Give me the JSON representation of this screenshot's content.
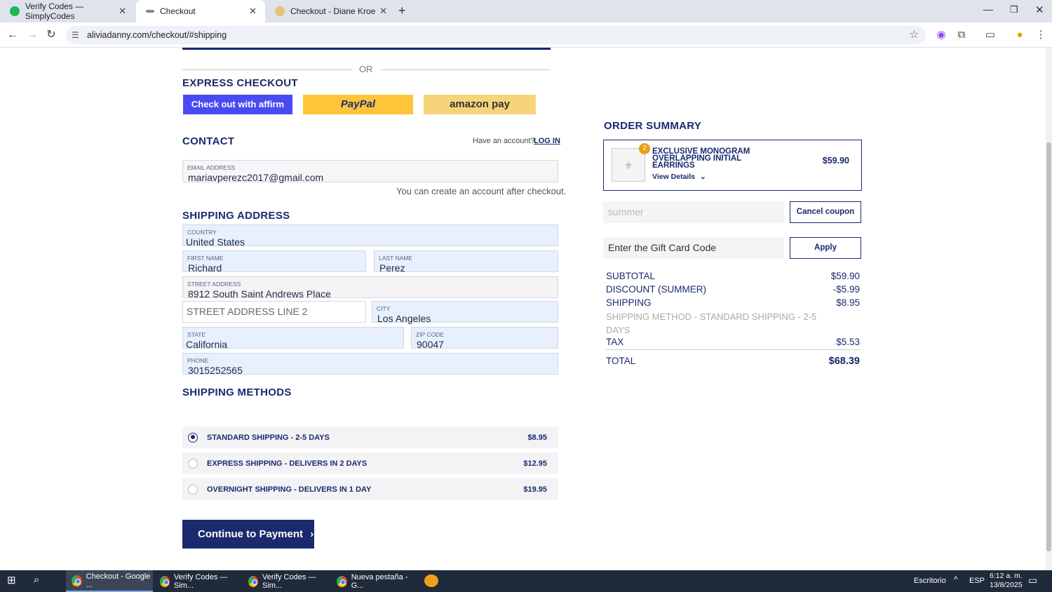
{
  "browser": {
    "tabs": [
      {
        "title": "Verify Codes — SimplyCodes"
      },
      {
        "title": "Checkout"
      },
      {
        "title": "Checkout - Diane Kroe"
      }
    ],
    "url": "aliviadanny.com/checkout/#shipping"
  },
  "express": {
    "or_label": "OR",
    "heading": "EXPRESS CHECKOUT",
    "affirm_label": "Check out with affirm",
    "paypal_label": "PayPal",
    "amazon_label": "amazon pay"
  },
  "contact": {
    "heading": "CONTACT",
    "have_account": "Have an account?",
    "login": "LOG IN",
    "email_label": "EMAIL ADDRESS",
    "email": "mariavperezc2017@gmail.com",
    "note": "You can create an account after checkout."
  },
  "shipping_address": {
    "heading": "SHIPPING ADDRESS",
    "country_label": "COUNTRY",
    "country": "United States",
    "first_label": "FIRST NAME",
    "first": "Richard",
    "last_label": "LAST NAME",
    "last": "Perez",
    "street_label": "STREET ADDRESS",
    "street": "8912 South Saint Andrews Place",
    "street2_placeholder": "STREET ADDRESS LINE 2",
    "city_label": "CITY",
    "city": "Los Angeles",
    "state_label": "STATE",
    "state": "California",
    "zip_label": "ZIP CODE",
    "zip": "90047",
    "phone_label": "PHONE",
    "phone": "3015252565"
  },
  "shipping_methods": {
    "heading": "SHIPPING METHODS",
    "options": [
      {
        "name": "STANDARD SHIPPING - 2-5 DAYS",
        "price": "$8.95",
        "selected": true
      },
      {
        "name": "EXPRESS SHIPPING - DELIVERS IN 2 DAYS",
        "price": "$12.95",
        "selected": false
      },
      {
        "name": "OVERNIGHT SHIPPING - DELIVERS IN 1 DAY",
        "price": "$19.95",
        "selected": false
      }
    ],
    "continue_label": "Continue to Payment"
  },
  "order_summary": {
    "heading": "ORDER SUMMARY",
    "item": {
      "qty": "2",
      "name": "EXCLUSIVE MONOGRAM OVERLAPPING INITIAL EARRINGS",
      "details": "View Details",
      "price": "$59.90"
    },
    "coupon_value": "summer",
    "cancel_coupon": "Cancel coupon",
    "gift_placeholder": "Enter the Gift Card Code",
    "apply": "Apply",
    "subtotal_label": "SUBTOTAL",
    "subtotal": "$59.90",
    "discount_label": "DISCOUNT (SUMMER)",
    "discount": "-$5.99",
    "shipping_label": "SHIPPING",
    "shipping": "$8.95",
    "shipping_method": "SHIPPING METHOD - STANDARD SHIPPING - 2-5 DAYS",
    "tax_label": "TAX",
    "tax": "$5.53",
    "total_label": "TOTAL",
    "total": "$68.39"
  },
  "taskbar": {
    "items": [
      "Checkout - Google ...",
      "Verify Codes — Sim...",
      "Verify Codes — Sim...",
      "Nueva pestaña - G..."
    ],
    "desktop": "Escritorio",
    "lang": "ESP",
    "time": "6:12 a. m.",
    "date": "13/8/2025"
  },
  "colors": {
    "navy": "#1a2a6c",
    "affirm": "#4a4af4",
    "paypal": "#ffc439",
    "amazon": "#f6d47a"
  }
}
